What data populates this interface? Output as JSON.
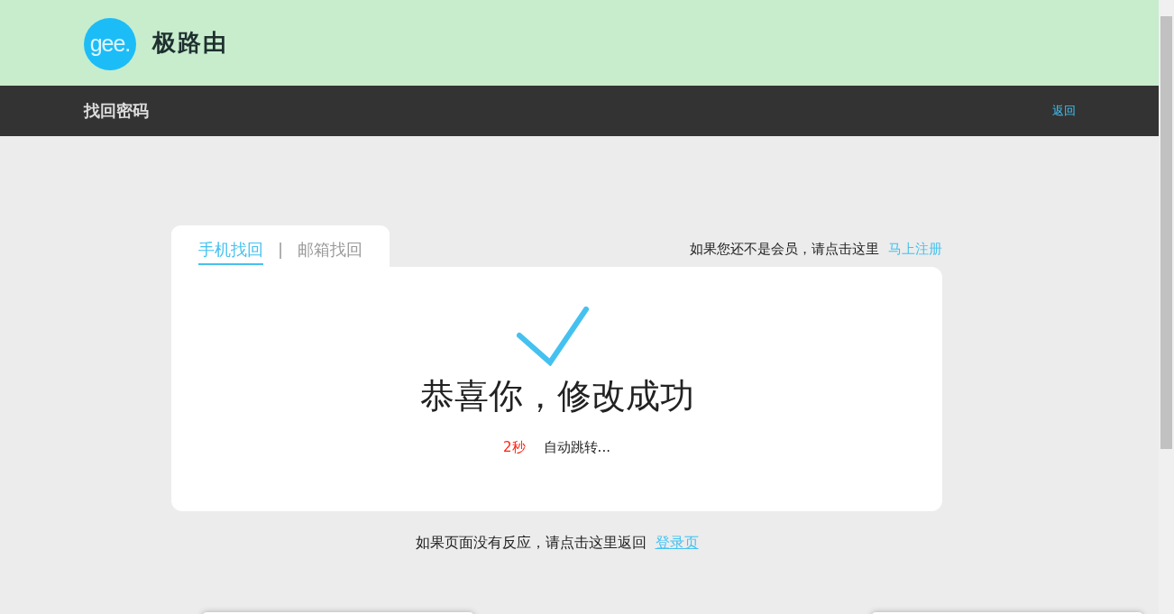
{
  "header": {
    "logo_text": "gee.",
    "brand": "极路由"
  },
  "nav": {
    "title": "找回密码",
    "back_link": "返回"
  },
  "tabs": [
    {
      "label": "手机找回",
      "selected": true
    },
    {
      "label": "邮箱找回",
      "selected": false
    }
  ],
  "tab_separator": "|",
  "register_prompt": {
    "text": "如果您还不是会员，请点击这里",
    "link": "马上注册"
  },
  "result": {
    "message": "恭喜你，修改成功",
    "countdown": "2秒",
    "redirect_text": "自动跳转..."
  },
  "footer_prompt": {
    "text": "如果页面没有反应，请点击这里返回",
    "link": "登录页"
  }
}
